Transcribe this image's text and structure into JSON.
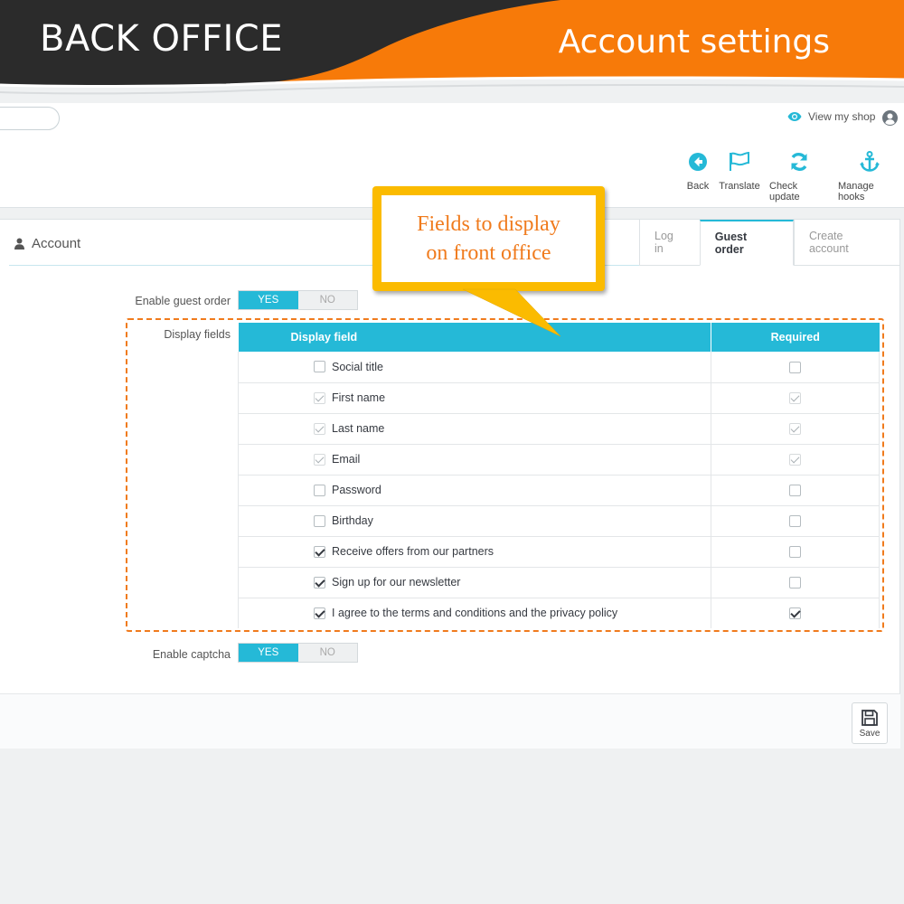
{
  "banner": {
    "left_title": "BACK OFFICE",
    "right_title": "Account settings",
    "colors": {
      "dark": "#2d2d2d",
      "orange": "#f77a09"
    }
  },
  "header": {
    "view_shop_label": "View my shop",
    "toolbar": [
      {
        "label": "Back",
        "icon": "back-arrow-icon"
      },
      {
        "label": "Translate",
        "icon": "flag-icon"
      },
      {
        "label": "Check update",
        "icon": "refresh-icon"
      },
      {
        "label": "Manage hooks",
        "icon": "anchor-icon"
      }
    ]
  },
  "callout": {
    "line1": "Fields to display",
    "line2": "on front office"
  },
  "panel": {
    "title": "Account",
    "tabs": [
      {
        "label": "Log in",
        "active": false
      },
      {
        "label": "Guest order",
        "active": true
      },
      {
        "label": "Create account",
        "active": false
      }
    ],
    "enable_guest_order": {
      "label": "Enable guest order",
      "yes": "YES",
      "no": "NO",
      "value": "YES"
    },
    "display_fields_label": "Display fields",
    "table": {
      "col_display": "Display field",
      "col_required": "Required",
      "rows": [
        {
          "field": "Social title",
          "display": "unchecked",
          "required": "unchecked"
        },
        {
          "field": "First name",
          "display": "locked",
          "required": "locked"
        },
        {
          "field": "Last name",
          "display": "locked",
          "required": "locked"
        },
        {
          "field": "Email",
          "display": "locked",
          "required": "locked"
        },
        {
          "field": "Password",
          "display": "unchecked",
          "required": "unchecked"
        },
        {
          "field": "Birthday",
          "display": "unchecked",
          "required": "unchecked"
        },
        {
          "field": "Receive offers from our partners",
          "display": "checked",
          "required": "unchecked"
        },
        {
          "field": "Sign up for our newsletter",
          "display": "checked",
          "required": "unchecked"
        },
        {
          "field": "I agree to the terms and conditions and the privacy policy",
          "display": "checked",
          "required": "checked"
        }
      ]
    },
    "enable_captcha": {
      "label": "Enable captcha",
      "yes": "YES",
      "no": "NO",
      "value": "YES"
    },
    "save_label": "Save"
  }
}
